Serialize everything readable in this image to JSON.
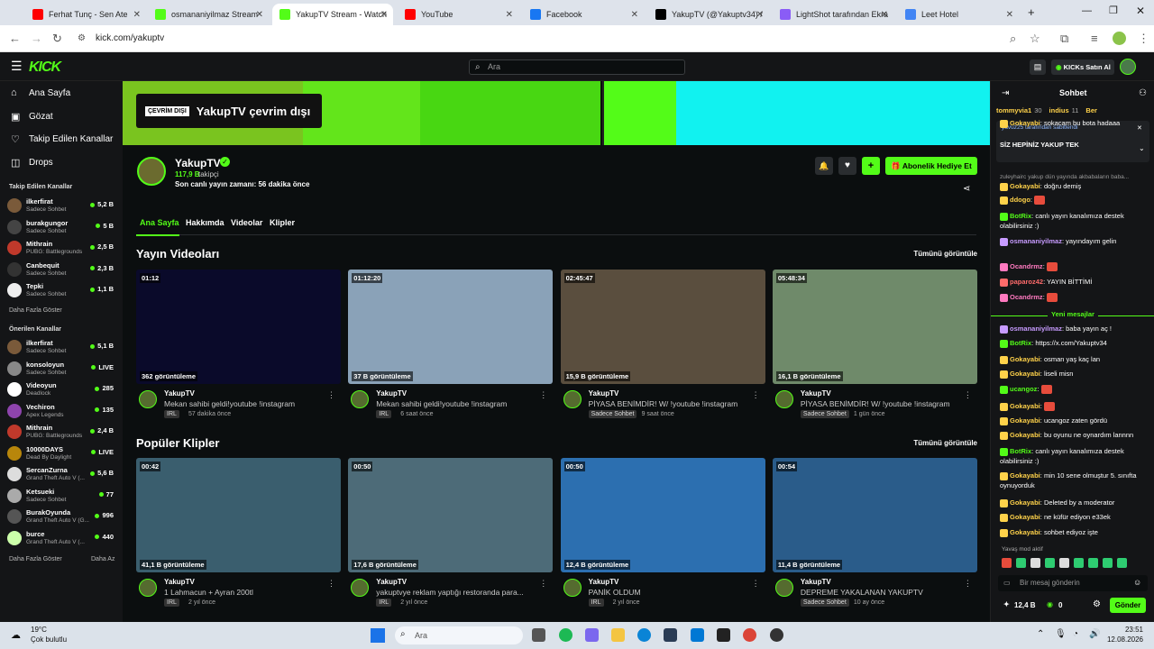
{
  "browser": {
    "tabs": [
      {
        "label": "Ferhat Tunç - Sen Ate",
        "favicon_color": "#ff0000"
      },
      {
        "label": "osmananiyilmaz Stream",
        "favicon_color": "#53fc18"
      },
      {
        "label": "YakupTV Stream - Watch",
        "favicon_color": "#53fc18"
      },
      {
        "label": "YouTube",
        "favicon_color": "#ff0000"
      },
      {
        "label": "Facebook",
        "favicon_color": "#1877f2"
      },
      {
        "label": "YakupTV (@Yakuptv34) /",
        "favicon_color": "#000000"
      },
      {
        "label": "LightShot tarafından Ekra",
        "favicon_color": "#8a5cf6"
      },
      {
        "label": "Leet Hotel",
        "favicon_color": "#4285f4"
      }
    ],
    "url": "kick.com/yakuptv"
  },
  "header": {
    "logo": "KICK",
    "search_placeholder": "Ara",
    "buy_kicks": "KICKs Satın Al"
  },
  "sidebar": {
    "nav": [
      {
        "label": "Ana Sayfa",
        "icon": "home-icon"
      },
      {
        "label": "Gözat",
        "icon": "browse-icon"
      },
      {
        "label": "Takip Edilen Kanallar",
        "icon": "heart-icon"
      },
      {
        "label": "Drops",
        "icon": "drops-icon"
      }
    ],
    "followed_title": "Takip Edilen Kanallar",
    "followed": [
      {
        "name": "ilkerfirat",
        "cat": "Sadece Sohbet",
        "viewers": "5,2 B",
        "color": "#7a5a3a"
      },
      {
        "name": "burakgungor",
        "cat": "Sadece Sohbet",
        "viewers": "5 B",
        "color": "#444"
      },
      {
        "name": "Mithrain",
        "cat": "PUBG: Battlegrounds",
        "viewers": "2,5 B",
        "color": "#c0392b"
      },
      {
        "name": "Canbequit",
        "cat": "Sadece Sohbet",
        "viewers": "2,3 B",
        "color": "#333"
      },
      {
        "name": "Tepki",
        "cat": "Sadece Sohbet",
        "viewers": "1,1 B",
        "color": "#eee"
      }
    ],
    "more1": "Daha Fazla Göster",
    "recommended_title": "Önerilen Kanallar",
    "recommended": [
      {
        "name": "ilkerfirat",
        "cat": "Sadece Sohbet",
        "viewers": "5,1 B",
        "color": "#7a5a3a"
      },
      {
        "name": "konsoloyun",
        "cat": "Sadece Sohbet",
        "viewers": "LIVE",
        "color": "#888"
      },
      {
        "name": "Videoyun",
        "cat": "Deadlock",
        "viewers": "285",
        "color": "#fff"
      },
      {
        "name": "Vechiron",
        "cat": "Apex Legends",
        "viewers": "135",
        "color": "#8e44ad"
      },
      {
        "name": "Mithrain",
        "cat": "PUBG: Battlegrounds",
        "viewers": "2,4 B",
        "color": "#c0392b"
      },
      {
        "name": "10000DAYS",
        "cat": "Dead By Daylight",
        "viewers": "LIVE",
        "color": "#b8860b"
      },
      {
        "name": "SercanZurna",
        "cat": "Grand Theft Auto V (...",
        "viewers": "5,6 B",
        "color": "#ddd"
      },
      {
        "name": "Ketsueki",
        "cat": "Sadece Sohbet",
        "viewers": "77",
        "color": "#aaa"
      },
      {
        "name": "BurakOyunda",
        "cat": "Grand Theft Auto V (G...",
        "viewers": "996",
        "color": "#555"
      },
      {
        "name": "burce",
        "cat": "Grand Theft Auto V (...",
        "viewers": "440",
        "color": "#cfa"
      }
    ],
    "more2": "Daha Fazla Göster",
    "less": "Daha Az"
  },
  "channel": {
    "offline_badge": "ÇEVRİM DIŞI",
    "offline_text": "YakupTV çevrim dışı",
    "name": "YakupTV",
    "followers": "117,9 B",
    "followers_label": "takipçi",
    "last_stream": "Son canlı yayın zamanı: 56 dakika önce",
    "gift_button": "Abonelik Hediye Et",
    "tabs": [
      "Ana Sayfa",
      "Hakkımda",
      "Videolar",
      "Klipler"
    ]
  },
  "videos": {
    "title": "Yayın Videoları",
    "see_all": "Tümünü görüntüle",
    "items": [
      {
        "duration": "01:12",
        "views": "362 görüntüleme",
        "channel": "YakupTV",
        "title": "Mekan sahibi geldi!youtube !instagram",
        "tag": "IRL",
        "time": "57 dakika önce",
        "bg": "#0a0a2a"
      },
      {
        "duration": "01:12:20",
        "views": "37 B görüntüleme",
        "channel": "YakupTV",
        "title": "Mekan sahibi geldi!youtube !instagram",
        "tag": "IRL",
        "time": "6 saat önce",
        "bg": "#8aa2b8"
      },
      {
        "duration": "02:45:47",
        "views": "15,9 B görüntüleme",
        "channel": "YakupTV",
        "title": "PİYASA BENİMDİR! W/ !youtube !instagram",
        "tag": "Sadece Sohbet",
        "time": "9 saat önce",
        "bg": "#5a4e3e"
      },
      {
        "duration": "05:48:34",
        "views": "16,1 B görüntüleme",
        "channel": "YakupTV",
        "title": "PİYASA BENİMDİR! W/ !youtube !instagram",
        "tag": "Sadece Sohbet",
        "time": "1 gün önce",
        "bg": "#6f8a6a"
      }
    ]
  },
  "clips": {
    "title": "Popüler Klipler",
    "see_all": "Tümünü görüntüle",
    "items": [
      {
        "duration": "00:42",
        "views": "41,1 B görüntüleme",
        "channel": "YakupTV",
        "title": "1 Lahmacun + Ayran 200tl",
        "tag": "IRL",
        "time": "2 yıl önce",
        "bg": "#3a5e6e"
      },
      {
        "duration": "00:50",
        "views": "17,6 B görüntüleme",
        "channel": "YakupTV",
        "title": "yakuptvye reklam yaptığı restoranda para...",
        "tag": "IRL",
        "time": "2 yıl önce",
        "bg": "#4d6b78"
      },
      {
        "duration": "00:50",
        "views": "12,4 B görüntüleme",
        "channel": "YakupTV",
        "title": "PANİK OLDUM",
        "tag": "IRL",
        "time": "2 yıl önce",
        "bg": "#2c6fb0"
      },
      {
        "duration": "00:54",
        "views": "11,4 B görüntüleme",
        "channel": "YakupTV",
        "title": "DEPREME YAKALANAN YAKUPTV",
        "tag": "Sadece Sohbet",
        "time": "10 ay önce",
        "bg": "#2a5c8a"
      }
    ]
  },
  "chat": {
    "title": "Sohbet",
    "top_gifters": [
      {
        "name": "tommyvia1",
        "n": "30"
      },
      {
        "name": "indius",
        "n": "11"
      },
      {
        "name": "Ber",
        "n": ""
      }
    ],
    "pinned_by": "yavuz25 tarafından sabitlendi",
    "pinned_msg": "SİZ HEPİNİZ YAKUP TEK",
    "messages": [
      {
        "user": "Gokayabi",
        "text": "sokacam bu bota hadaaa",
        "color": "#ffd24a"
      },
      {
        "user": "",
        "text": "zuleyhairc yakup dün yayında akbabaların baba...",
        "color": "#999"
      },
      {
        "user": "Gokayabi",
        "text": "doğru demiş",
        "color": "#ffd24a"
      },
      {
        "user": "ddogo",
        "text": "",
        "color": "#ffd24a"
      },
      {
        "user": "BotRix",
        "text": "canlı yayın kanalımıza destek olabilirsiniz :)",
        "color": "#53fc18"
      },
      {
        "user": "osmananiyilmaz",
        "text": "yayındayım gelin",
        "color": "#c79bff"
      },
      {
        "user": "Ocandrmz",
        "text": "",
        "color": "#ff7ac0"
      },
      {
        "user": "paparoz42",
        "text": "YAYIN BİTTİMİ",
        "color": "#ff6b6b"
      },
      {
        "user": "Ocandrmz",
        "text": "",
        "color": "#ff7ac0"
      }
    ],
    "new_messages": "Yeni mesajlar",
    "messages2": [
      {
        "user": "osmananiyilmaz",
        "text": "baba yayın aç !",
        "color": "#c79bff"
      },
      {
        "user": "BotRix",
        "text": "https://x.com/Yakuptv34",
        "color": "#53fc18"
      },
      {
        "user": "Gokayabi",
        "text": "osman yaş kaç lan",
        "color": "#ffd24a"
      },
      {
        "user": "Gokayabi",
        "text": "liseli misn",
        "color": "#ffd24a"
      },
      {
        "user": "ucangoz",
        "text": "",
        "color": "#53fc18"
      },
      {
        "user": "Gokayabi",
        "text": "",
        "color": "#ffd24a"
      },
      {
        "user": "Gokayabi",
        "text": "ucangoz zaten gördü",
        "color": "#ffd24a"
      },
      {
        "user": "Gokayabi",
        "text": "bu oyunu ne oynardım lannnn",
        "color": "#ffd24a"
      },
      {
        "user": "BotRix",
        "text": "canlı yayın kanalımıza destek olabilirsiniz :)",
        "color": "#53fc18"
      },
      {
        "user": "Gokayabi",
        "text": "min 10 sene olmuştur 5. sınıfta oynuyorduk",
        "color": "#ffd24a"
      },
      {
        "user": "Gokayabi",
        "text": "Deleted by a moderator",
        "color": "#ffd24a"
      },
      {
        "user": "Gokayabi",
        "text": "ne küfür ediyon e33ek",
        "color": "#ffd24a"
      },
      {
        "user": "Gokayabi",
        "text": "sohbet ediyoz işte",
        "color": "#ffd24a"
      }
    ],
    "slow_mode": "Yavaş mod aktif",
    "input_placeholder": "Bir mesaj gönderin",
    "points": "12,4 B",
    "kicks": "0",
    "send": "Gönder"
  },
  "taskbar": {
    "weather_temp": "19°C",
    "weather_text": "Çok bulutlu",
    "search": "Ara",
    "time": "23:51",
    "date": "12.08.2026"
  }
}
